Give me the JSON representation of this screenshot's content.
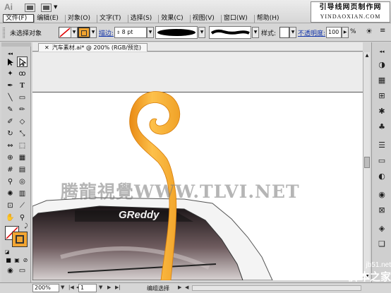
{
  "app": {
    "logo": "Ai"
  },
  "menu": [
    {
      "label": "文件(F)",
      "active": true
    },
    {
      "label": "编辑(E)"
    },
    {
      "label": "对象(O)"
    },
    {
      "label": "文字(T)"
    },
    {
      "label": "选择(S)"
    },
    {
      "label": "效果(C)"
    },
    {
      "label": "视图(V)"
    },
    {
      "label": "窗口(W)"
    },
    {
      "label": "帮助(H)"
    }
  ],
  "site_badge": {
    "cn": "引导线网页制作网",
    "en": "YINDAOXIAN.COM"
  },
  "control": {
    "selection_label": "未选择对象",
    "stroke_label": "描边:",
    "stroke_weight": "8 pt",
    "style_label": "样式:",
    "opacity_label": "不透明度:",
    "opacity_value": "100",
    "opacity_unit": "%"
  },
  "document": {
    "tab_title": "汽车素材.ai* @ 200% (RGB/预览)",
    "car_brand": "GReddy"
  },
  "status": {
    "zoom": "200%",
    "page": "1",
    "tool_text": "编组选择"
  },
  "watermarks": {
    "main": "腾龍視覺WWW.TLVI.NET",
    "jb_line1": "jb51.net",
    "jb_line2": "脚本之家"
  },
  "colors": {
    "fill_swatch": "#f2a531",
    "swirl_light": "#fdc04a",
    "swirl_dark": "#e98a14",
    "link": "#1133aa"
  }
}
